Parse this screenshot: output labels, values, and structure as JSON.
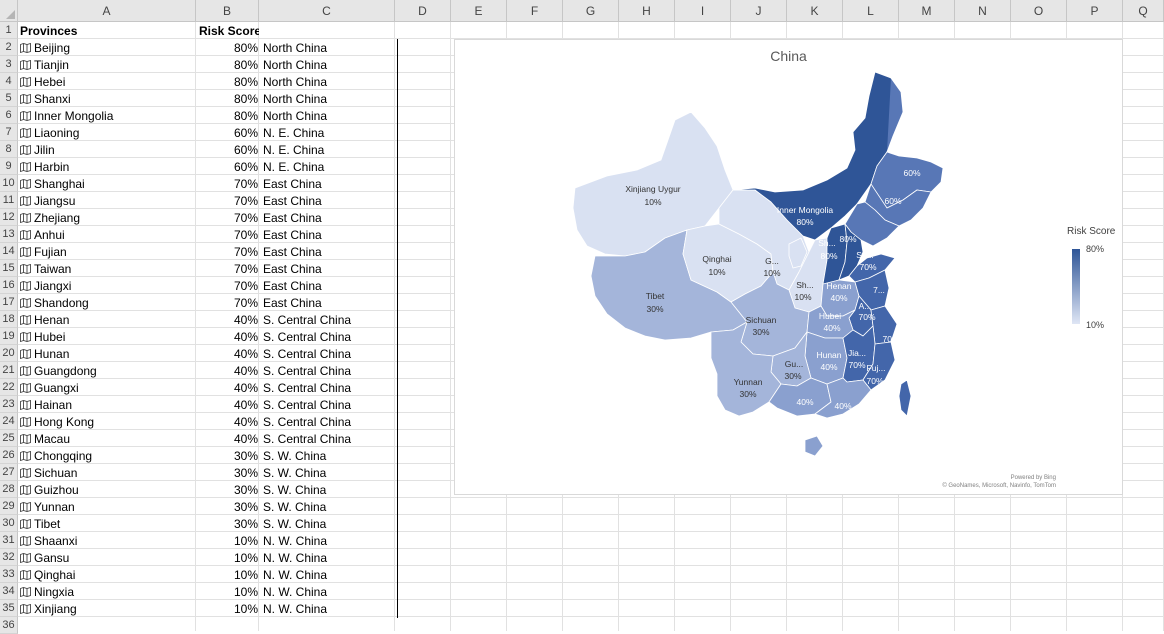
{
  "columns": [
    "A",
    "B",
    "C",
    "D",
    "E",
    "F",
    "G",
    "H",
    "I",
    "J",
    "K",
    "L",
    "M",
    "N",
    "O",
    "P",
    "Q"
  ],
  "headers": {
    "a": "Provinces",
    "b": "Risk Score"
  },
  "rows": [
    {
      "name": "Beijing",
      "score": "80%",
      "region": "North China"
    },
    {
      "name": "Tianjin",
      "score": "80%",
      "region": "North China"
    },
    {
      "name": "Hebei",
      "score": "80%",
      "region": "North China"
    },
    {
      "name": "Shanxi",
      "score": "80%",
      "region": "North China"
    },
    {
      "name": "Inner Mongolia",
      "score": "80%",
      "region": "North China"
    },
    {
      "name": "Liaoning",
      "score": "60%",
      "region": "N. E. China"
    },
    {
      "name": "Jilin",
      "score": "60%",
      "region": "N. E. China"
    },
    {
      "name": "Harbin",
      "score": "60%",
      "region": "N. E. China"
    },
    {
      "name": "Shanghai",
      "score": "70%",
      "region": "East China"
    },
    {
      "name": "Jiangsu",
      "score": "70%",
      "region": "East China"
    },
    {
      "name": "Zhejiang",
      "score": "70%",
      "region": "East China"
    },
    {
      "name": "Anhui",
      "score": "70%",
      "region": "East China"
    },
    {
      "name": "Fujian",
      "score": "70%",
      "region": "East China"
    },
    {
      "name": "Taiwan",
      "score": "70%",
      "region": "East China"
    },
    {
      "name": "Jiangxi",
      "score": "70%",
      "region": "East China"
    },
    {
      "name": "Shandong",
      "score": "70%",
      "region": "East China"
    },
    {
      "name": "Henan",
      "score": "40%",
      "region": "S. Central China"
    },
    {
      "name": "Hubei",
      "score": "40%",
      "region": "S. Central China"
    },
    {
      "name": "Hunan",
      "score": "40%",
      "region": "S. Central China"
    },
    {
      "name": "Guangdong",
      "score": "40%",
      "region": "S. Central China"
    },
    {
      "name": "Guangxi",
      "score": "40%",
      "region": "S. Central China"
    },
    {
      "name": "Hainan",
      "score": "40%",
      "region": "S. Central China"
    },
    {
      "name": "Hong Kong",
      "score": "40%",
      "region": "S. Central China"
    },
    {
      "name": "Macau",
      "score": "40%",
      "region": "S. Central China"
    },
    {
      "name": "Chongqing",
      "score": "30%",
      "region": "S. W. China"
    },
    {
      "name": "Sichuan",
      "score": "30%",
      "region": "S. W. China"
    },
    {
      "name": "Guizhou",
      "score": "30%",
      "region": "S. W. China"
    },
    {
      "name": "Yunnan",
      "score": "30%",
      "region": "S. W. China"
    },
    {
      "name": "Tibet",
      "score": "30%",
      "region": "S. W. China"
    },
    {
      "name": "Shaanxi",
      "score": "10%",
      "region": "N. W. China"
    },
    {
      "name": "Gansu",
      "score": "10%",
      "region": "N. W. China"
    },
    {
      "name": "Qinghai",
      "score": "10%",
      "region": "N. W. China"
    },
    {
      "name": "Ningxia",
      "score": "10%",
      "region": "N. W. China"
    },
    {
      "name": "Xinjiang",
      "score": "10%",
      "region": "N. W. China"
    }
  ],
  "chart": {
    "title": "China",
    "legend_title": "Risk Score",
    "legend_max": "80%",
    "legend_min": "10%",
    "credit1": "Powered by Bing",
    "credit2": "© GeoNames, Microsoft, Navinfo, TomTom",
    "labels": [
      {
        "t": "Xinjiang Uygur"
      },
      {
        "t": "10%"
      },
      {
        "t": "Inner Mongolia"
      },
      {
        "t": "80%"
      },
      {
        "t": "60%"
      },
      {
        "t": "60%"
      },
      {
        "t": "Sh..."
      },
      {
        "t": "80%"
      },
      {
        "t": "80%"
      },
      {
        "t": "Sh..."
      },
      {
        "t": "70%"
      },
      {
        "t": "Qinghai"
      },
      {
        "t": "10%"
      },
      {
        "t": "G..."
      },
      {
        "t": "10%"
      },
      {
        "t": "Sh..."
      },
      {
        "t": "10%"
      },
      {
        "t": "Henan"
      },
      {
        "t": "40%"
      },
      {
        "t": "7..."
      },
      {
        "t": "A..."
      },
      {
        "t": "70%"
      },
      {
        "t": "Tibet"
      },
      {
        "t": "30%"
      },
      {
        "t": "Sichuan"
      },
      {
        "t": "30%"
      },
      {
        "t": "Hubei"
      },
      {
        "t": "40%"
      },
      {
        "t": "70%"
      },
      {
        "t": "Hunan"
      },
      {
        "t": "40%"
      },
      {
        "t": "Jia..."
      },
      {
        "t": "70%"
      },
      {
        "t": "Gu..."
      },
      {
        "t": "30%"
      },
      {
        "t": "Fuj..."
      },
      {
        "t": "70%"
      },
      {
        "t": "Yunnan"
      },
      {
        "t": "30%"
      },
      {
        "t": "40%"
      },
      {
        "t": "40%"
      }
    ]
  },
  "colors": {
    "dark": "#2f5597",
    "mid60": "#5877b6",
    "mid70": "#4366aa",
    "mid40": "#8aa0cf",
    "mid30": "#a4b5da",
    "light": "#d9e1f2"
  }
}
